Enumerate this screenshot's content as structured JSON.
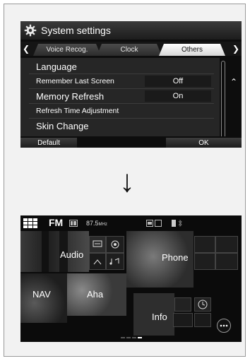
{
  "settings_screen": {
    "title": "System settings",
    "tabs": [
      {
        "label": "Voice Recog."
      },
      {
        "label": "Clock"
      },
      {
        "label": "Others",
        "active": true
      }
    ],
    "rows": [
      {
        "label": "Language",
        "value": ""
      },
      {
        "label": "Remember Last Screen",
        "value": "Off"
      },
      {
        "label": "Memory Refresh",
        "value": "On"
      },
      {
        "label": "Refresh Time Adjustment",
        "value": ""
      },
      {
        "label": "Skin Change",
        "value": ""
      }
    ],
    "buttons": {
      "default_label": "Default",
      "ok_label": "OK"
    },
    "icons": {
      "title": "gear-icon",
      "tab_prev": "chevron-left-icon",
      "tab_next": "chevron-right-icon",
      "scroll_up": "double-chevron-up-icon",
      "scroll_down": "double-chevron-down-icon"
    }
  },
  "transition_arrow": "↓",
  "home_screen": {
    "status": {
      "band": "FM",
      "frequency": "87.5",
      "unit": "MHz"
    },
    "tiles": {
      "audio": "Audio",
      "phone": "Phone",
      "nav": "NAV",
      "aha": "Aha",
      "info": "Info"
    },
    "icons": [
      "apps-grid-icon",
      "radio-source-icon",
      "media-icon",
      "signal-icon",
      "bluetooth-icon",
      "podcast-icon",
      "clock-icon",
      "more-icon"
    ]
  },
  "colors": {
    "screen_bg": "#0d0d0d",
    "active_tab": "#ffffff",
    "frame_bg": "#f2f2f2"
  }
}
